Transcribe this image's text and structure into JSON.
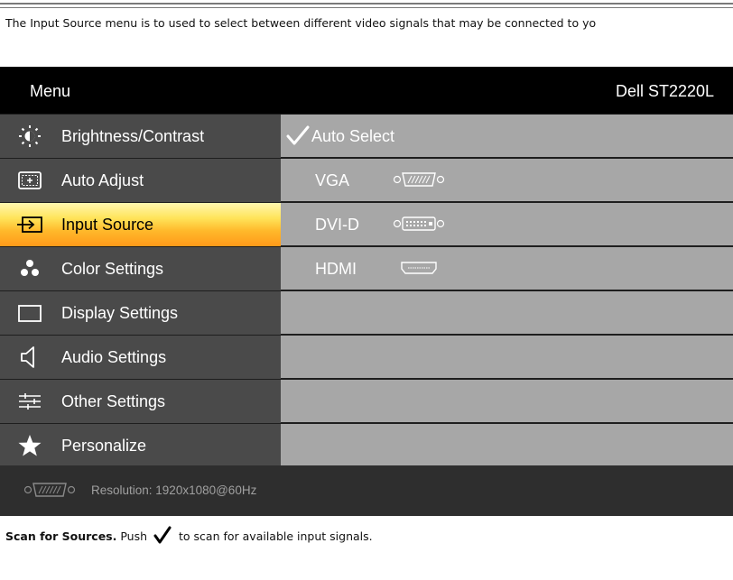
{
  "intro_text": "The Input Source menu is to used to select between different video signals that may be connected to yo",
  "osd": {
    "title": "Menu",
    "model": "Dell ST2220L",
    "menu_items": [
      {
        "label": "Brightness/Contrast",
        "icon": "brightness-icon"
      },
      {
        "label": "Auto Adjust",
        "icon": "auto-adjust-icon"
      },
      {
        "label": "Input Source",
        "icon": "input-source-icon",
        "selected": true
      },
      {
        "label": "Color Settings",
        "icon": "color-settings-icon"
      },
      {
        "label": "Display Settings",
        "icon": "display-settings-icon"
      },
      {
        "label": "Audio Settings",
        "icon": "audio-settings-icon"
      },
      {
        "label": "Other Settings",
        "icon": "other-settings-icon"
      },
      {
        "label": "Personalize",
        "icon": "star-icon"
      }
    ],
    "options": [
      {
        "label": "Auto Select",
        "checked": true
      },
      {
        "label": "VGA",
        "connector": "vga-connector-icon"
      },
      {
        "label": "DVI-D",
        "connector": "dvi-connector-icon"
      },
      {
        "label": "HDMI",
        "connector": "hdmi-connector-icon"
      },
      {
        "label": ""
      },
      {
        "label": ""
      },
      {
        "label": ""
      },
      {
        "label": ""
      }
    ],
    "footer": {
      "connector": "vga-connector-icon",
      "resolution": "Resolution: 1920x1080@60Hz"
    }
  },
  "scan": {
    "bold": "Scan for Sources.",
    "before_icon": "Push",
    "after_icon": "to scan for available input signals."
  },
  "colors": {
    "osd_background": "#000000",
    "menu_item": "#4a4a4a",
    "option_row": "#a7a7a7",
    "selected_highlight": "#ffb82a",
    "footer": "#2e2e2e"
  }
}
